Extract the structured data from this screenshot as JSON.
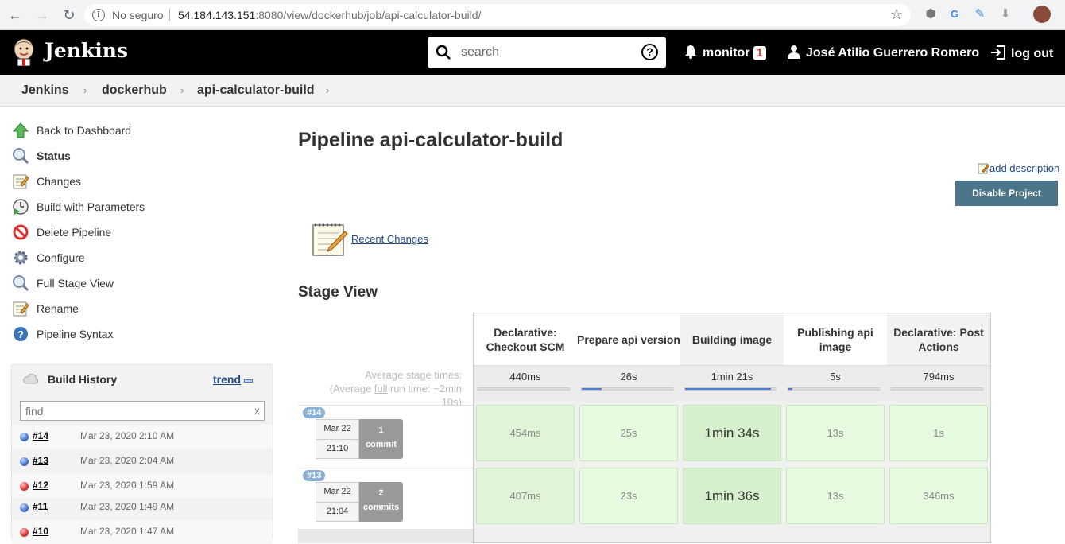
{
  "browser": {
    "insecure_label": "No seguro",
    "url_host": "54.184.143.151",
    "url_rest": ":8080/view/dockerhub/job/api-calculator-build/"
  },
  "header": {
    "brand": "Jenkins",
    "search_placeholder": "search",
    "monitor_label": "monitor",
    "monitor_count": "1",
    "user_name": "José Atilio Guerrero Romero",
    "logout_label": "log out"
  },
  "breadcrumb": [
    "Jenkins",
    "dockerhub",
    "api-calculator-build"
  ],
  "sidebar": {
    "tasks": [
      {
        "label": "Back to Dashboard",
        "icon": "up-arrow-icon"
      },
      {
        "label": "Status",
        "icon": "magnifier-icon"
      },
      {
        "label": "Changes",
        "icon": "notepad-icon"
      },
      {
        "label": "Build with Parameters",
        "icon": "clock-play-icon"
      },
      {
        "label": "Delete Pipeline",
        "icon": "no-entry-icon"
      },
      {
        "label": "Configure",
        "icon": "gear-icon"
      },
      {
        "label": "Full Stage View",
        "icon": "magnifier-icon"
      },
      {
        "label": "Rename",
        "icon": "notepad-icon"
      },
      {
        "label": "Pipeline Syntax",
        "icon": "help-icon"
      }
    ]
  },
  "build_history": {
    "title": "Build History",
    "trend_label": "trend",
    "filter_placeholder": "find",
    "builds": [
      {
        "num": "#14",
        "date": "Mar 23, 2020 2:10 AM",
        "status": "blue"
      },
      {
        "num": "#13",
        "date": "Mar 23, 2020 2:04 AM",
        "status": "blue"
      },
      {
        "num": "#12",
        "date": "Mar 23, 2020 1:59 AM",
        "status": "red"
      },
      {
        "num": "#11",
        "date": "Mar 23, 2020 1:49 AM",
        "status": "blue"
      },
      {
        "num": "#10",
        "date": "Mar 23, 2020 1:47 AM",
        "status": "red"
      }
    ]
  },
  "main": {
    "title": "Pipeline api-calculator-build",
    "add_description": "add description",
    "disable_button": "Disable Project",
    "recent_changes": "Recent Changes",
    "stage_view_title": "Stage View"
  },
  "stage_view": {
    "avg_line1": "Average stage times:",
    "avg_line2_pre": "(Average ",
    "avg_line2_link": "full",
    "avg_line2_post": " run time: ~2min",
    "avg_line3": "10s)",
    "stages": [
      {
        "name": "Declarative: Checkout SCM",
        "avg": "440ms",
        "fill_pct": 0
      },
      {
        "name": "Prepare api version",
        "avg": "26s",
        "fill_pct": 22
      },
      {
        "name": "Building image",
        "avg": "1min 21s",
        "fill_pct": 95
      },
      {
        "name": "Publishing api image",
        "avg": "5s",
        "fill_pct": 4
      },
      {
        "name": "Declarative: Post Actions",
        "avg": "794ms",
        "fill_pct": 0
      }
    ],
    "runs": [
      {
        "badge": "#14",
        "date": "Mar 22",
        "time": "21:10",
        "commit_count": "1",
        "commit_label": "commit",
        "times": [
          "454ms",
          "25s",
          "1min 34s",
          "13s",
          "1s"
        ]
      },
      {
        "badge": "#13",
        "date": "Mar 22",
        "time": "21:04",
        "commit_count": "2",
        "commit_label": "commits",
        "times": [
          "407ms",
          "23s",
          "1min 36s",
          "13s",
          "346ms"
        ]
      }
    ]
  }
}
